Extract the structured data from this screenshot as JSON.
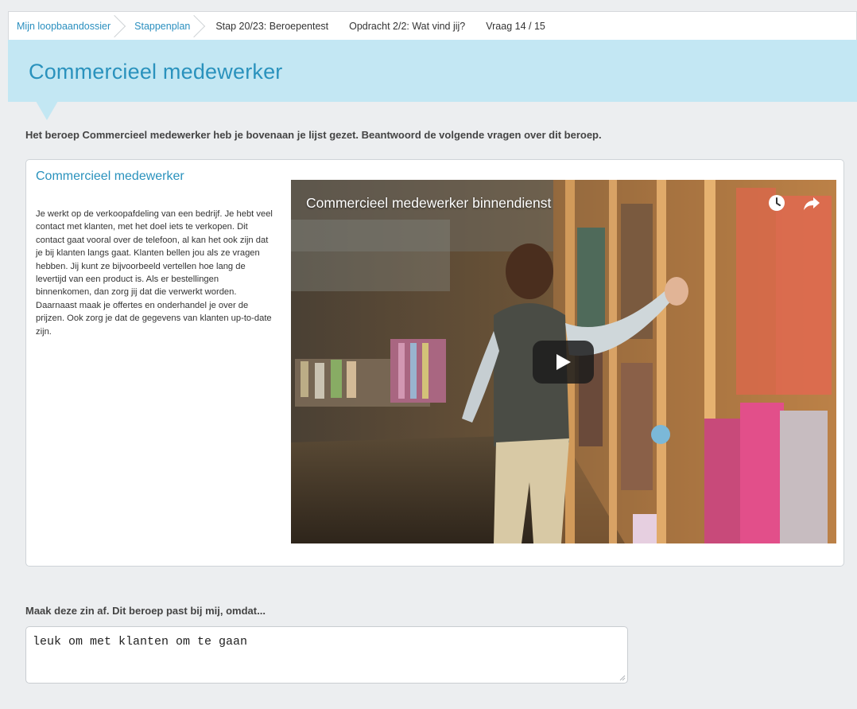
{
  "breadcrumb": {
    "items": [
      {
        "label": "Mijn loopbaandossier"
      },
      {
        "label": "Stappenplan"
      },
      {
        "label": "Stap 20/23: Beroepentest"
      },
      {
        "label": "Opdracht 2/2: Wat vind jij?"
      },
      {
        "label": "Vraag 14 / 15"
      }
    ]
  },
  "header": {
    "title": "Commercieel medewerker"
  },
  "intro": "Het beroep Commercieel medewerker heb je bovenaan je lijst gezet. Beantwoord de volgende vragen over dit beroep.",
  "card": {
    "title": "Commercieel medewerker",
    "description": "Je werkt op de verkoopafdeling van een bedrijf. Je hebt veel contact met klanten, met het doel iets te verkopen. Dit contact gaat vooral over de telefoon, al kan het ook zijn dat je bij klanten langs gaat. Klanten bellen jou als ze vragen hebben. Jij kunt ze bijvoorbeeld vertellen hoe lang de levertijd van een product is. Als er bestellingen binnenkomen, dan zorg jij dat die verwerkt worden. Daarnaast maak je offertes en onderhandel je over de prijzen. Ook zorg je dat de gegevens van klanten up-to-date zijn."
  },
  "video": {
    "title": "Commercieel medewerker binnendienst",
    "icons": [
      "clock-icon",
      "share-icon",
      "play-icon"
    ]
  },
  "question": {
    "prompt": "Maak deze zin af. Dit beroep past bij mij, omdat...",
    "answer": "leuk om met klanten om te gaan"
  },
  "colors": {
    "accent": "#2a92bd",
    "band": "#c3e7f3",
    "background": "#eceef0"
  }
}
